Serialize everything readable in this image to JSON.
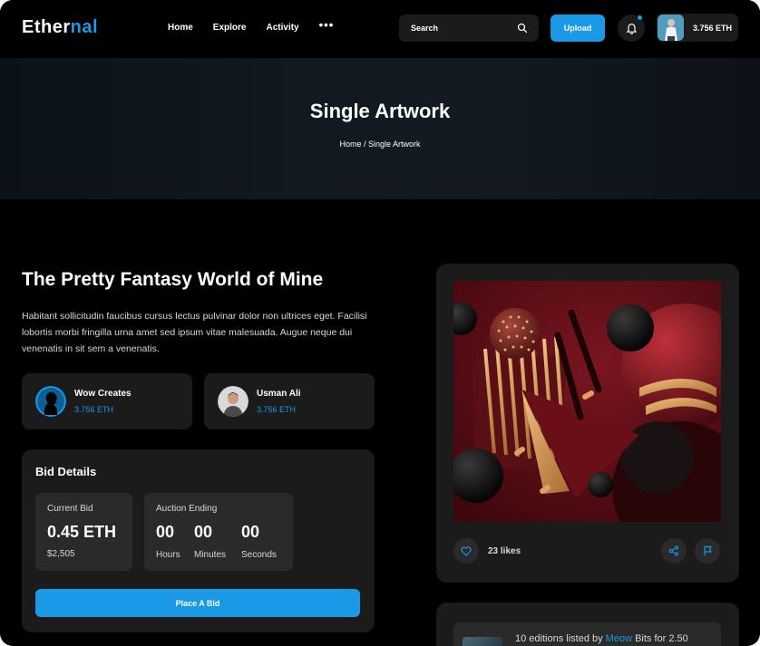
{
  "brand": {
    "logo_main": "Ether",
    "logo_accent": "nal"
  },
  "nav": {
    "items": [
      "Home",
      "Explore",
      "Activity"
    ],
    "more": "•••"
  },
  "search": {
    "placeholder": "Search"
  },
  "header": {
    "upload_label": "Upload",
    "balance": "3.756 ETH"
  },
  "banner": {
    "title": "Single Artwork",
    "crumb_home": "Home",
    "crumb_sep": " / ",
    "crumb_current": "Single Artwork"
  },
  "artwork": {
    "title": "The Pretty Fantasy World of Mine",
    "description": "Habitant sollicitudin faucibus cursus lectus pulvinar dolor non ultrices eget. Facilisi lobortis morbi fringilla urna amet sed ipsum vitae malesuada. Augue neque dui venenatis in sit sem a venenatis.",
    "likes": "23 likes"
  },
  "people": [
    {
      "name": "Wow Creates",
      "value": "3.756 ETH"
    },
    {
      "name": "Usman Ali",
      "value": "3.756 ETH"
    }
  ],
  "bid": {
    "title": "Bid Details",
    "current_label": "Current Bid",
    "current_value": "0.45 ETH",
    "current_usd": "$2,505",
    "auction_label": "Auction Ending",
    "countdown": [
      {
        "value": "00",
        "unit": "Hours"
      },
      {
        "value": "00",
        "unit": "Minutes"
      },
      {
        "value": "00",
        "unit": "Seconds"
      }
    ],
    "place_label": "Place A Bid"
  },
  "editions": {
    "text_before": "10 editions listed by ",
    "user": "Meow",
    "text_after": " Bits for 2.50"
  },
  "colors": {
    "accent": "#1a9ae6",
    "background": "#000000",
    "card": "#1b1b1b",
    "inner": "#2a2a2a"
  }
}
